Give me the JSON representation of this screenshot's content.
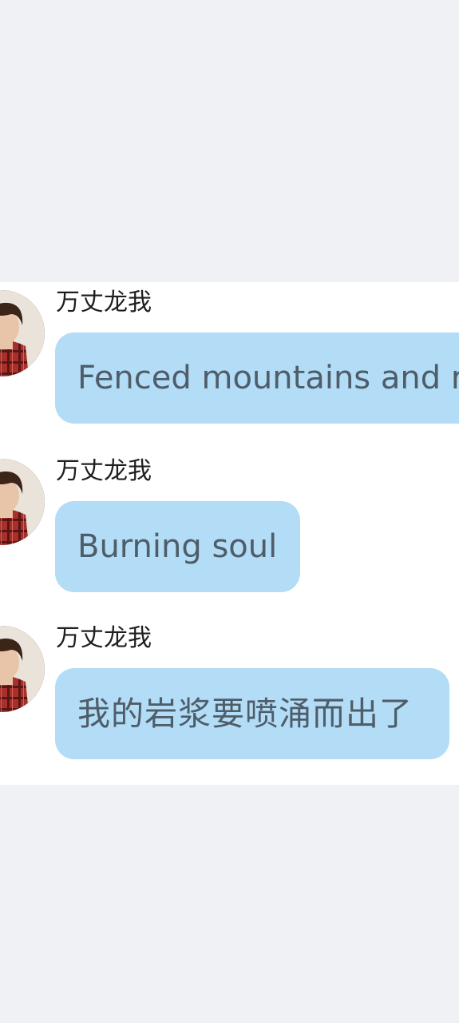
{
  "messages": [
    {
      "sender": "万丈龙我",
      "text": "Fenced mountains and r",
      "avatar": "user-avatar"
    },
    {
      "sender": "万丈龙我",
      "text": "Burning soul",
      "avatar": "user-avatar"
    },
    {
      "sender": "万丈龙我",
      "text": "我的岩浆要喷涌而出了",
      "avatar": "user-avatar"
    }
  ],
  "colors": {
    "page_background": "#eff1f4",
    "panel_background": "#ffffff",
    "bubble_background": "#b3dcf7",
    "bubble_text": "#4e5d68",
    "sender_text": "#1f1f1f"
  }
}
